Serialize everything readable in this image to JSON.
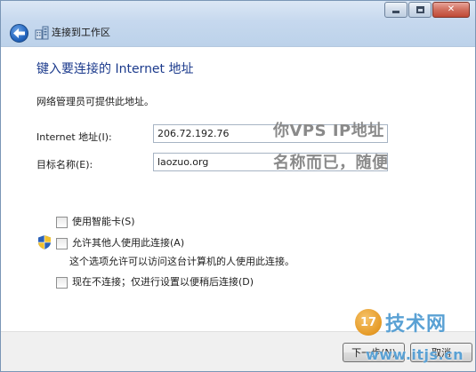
{
  "window": {
    "title": "连接到工作区",
    "heading": "键入要连接的 Internet 地址",
    "description": "网络管理员可提供此地址。"
  },
  "fields": {
    "address_label": "Internet 地址(I):",
    "address_value": "206.72.192.76",
    "name_label": "目标名称(E):",
    "name_value": "laozuo.org"
  },
  "annotations": {
    "address_note": "你VPS IP地址",
    "name_note": "名称而已，随便"
  },
  "options": {
    "smartcard_label": "使用智能卡(S)",
    "allow_others_label": "允许其他人使用此连接(A)",
    "allow_others_desc": "这个选项允许可以访问这台计算机的人使用此连接。",
    "connect_later_label": "现在不连接；仅进行设置以便稍后连接(D)"
  },
  "footer": {
    "next_label": "下一步(N)",
    "cancel_label": "取消"
  },
  "watermark": {
    "badge": "17",
    "brand": "技术网",
    "url": "www.itjs.cn"
  },
  "icons": {
    "back": "back-arrow-icon",
    "wizard": "network-workplace-icon",
    "shield": "uac-shield-icon"
  },
  "colors": {
    "heading": "#1b3a8c",
    "title_glass": "#c6d8ee",
    "watermark": "#5aa1d4",
    "watermark_badge": "#e59a26"
  }
}
